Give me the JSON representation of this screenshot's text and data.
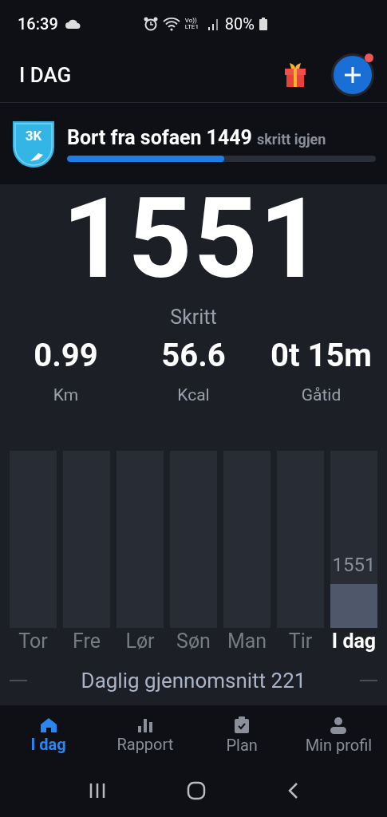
{
  "status_bar": {
    "time": "16:39",
    "network": "Vo)) LTE1",
    "battery": "80%"
  },
  "app_bar": {
    "title": "I DAG",
    "notification": true
  },
  "challenge": {
    "badge": "3K",
    "title": "Bort fra sofaen",
    "remaining": "1449",
    "remaining_label": "skritt igjen",
    "level": 0.51
  },
  "steps": {
    "value": "1551",
    "label": "Skritt"
  },
  "stats": [
    {
      "value": "0.99",
      "label": "Km"
    },
    {
      "value": "56.6",
      "label": "Kcal"
    },
    {
      "value": "0t 15m",
      "label": "Gåtid"
    }
  ],
  "days": [
    {
      "label": "Tor",
      "selected": false
    },
    {
      "label": "Fre",
      "selected": false
    },
    {
      "label": "Lør",
      "selected": false
    },
    {
      "label": "Søn",
      "selected": false
    },
    {
      "label": "Man",
      "selected": false
    },
    {
      "label": "Tir",
      "selected": false
    },
    {
      "label": "I dag",
      "level": 0.25,
      "selected": true,
      "value_label": "1551"
    }
  ],
  "average": "Daglig gjennomsnitt 221",
  "bottom_nav": [
    {
      "label": "I dag",
      "kind": "home",
      "selected": true
    },
    {
      "label": "Rapport",
      "kind": "chart",
      "selected": false
    },
    {
      "label": "Plan",
      "kind": "clipboard",
      "selected": false
    },
    {
      "label": "Min profil",
      "kind": "person",
      "selected": false
    }
  ]
}
